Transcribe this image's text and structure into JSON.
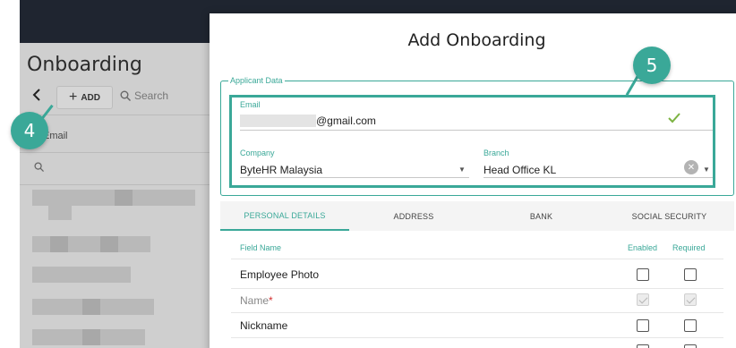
{
  "background": {
    "page_title": "Onboarding",
    "add_button_label": "ADD",
    "search_placeholder": "Search",
    "column_email": "Email"
  },
  "badges": {
    "step4": "4",
    "step5": "5"
  },
  "modal": {
    "title": "Add Onboarding",
    "applicant_legend": "Applicant Data",
    "email": {
      "label": "Email",
      "value_suffix": "@gmail.com"
    },
    "company": {
      "label": "Company",
      "value": "ByteHR Malaysia"
    },
    "branch": {
      "label": "Branch",
      "value": "Head Office KL"
    },
    "tabs": [
      "PERSONAL DETAILS",
      "ADDRESS",
      "BANK",
      "SOCIAL SECURITY"
    ],
    "columns": {
      "field_name": "Field Name",
      "enabled": "Enabled",
      "required": "Required"
    },
    "rows": [
      {
        "label": "Employee Photo"
      },
      {
        "label": "Name",
        "required_mark": "*"
      },
      {
        "label": "Nickname"
      }
    ]
  },
  "colors": {
    "accent": "#3aa898",
    "check": "#7cb342",
    "required": "#d32f2f"
  },
  "icons": {
    "back": "chevron-left-icon",
    "add": "plus-icon",
    "search": "search-icon",
    "valid": "check-icon",
    "dropdown": "caret-down-icon",
    "clear": "clear-icon"
  }
}
